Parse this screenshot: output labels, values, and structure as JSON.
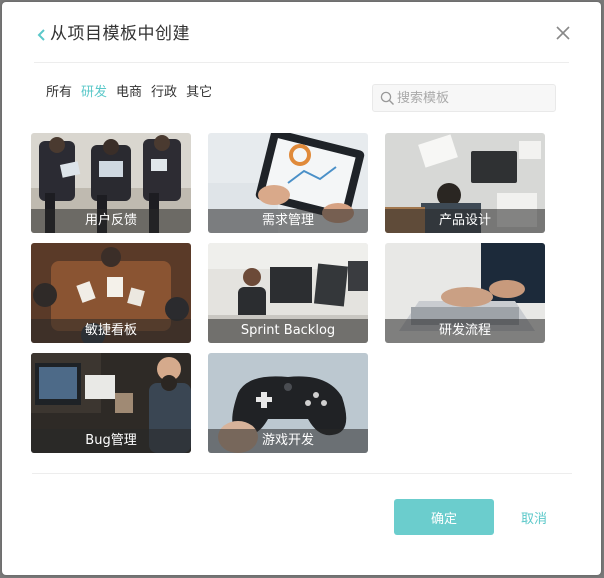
{
  "dialog": {
    "title": "从项目模板中创建",
    "back_icon": "chevron-left-icon",
    "close_icon": "close-icon"
  },
  "tabs": [
    {
      "label": "所有",
      "active": false
    },
    {
      "label": "研发",
      "active": true
    },
    {
      "label": "电商",
      "active": false
    },
    {
      "label": "行政",
      "active": false
    },
    {
      "label": "其它",
      "active": false
    }
  ],
  "search": {
    "placeholder": "搜索模板",
    "value": "",
    "icon": "search-icon"
  },
  "templates": [
    {
      "label": "用户反馈"
    },
    {
      "label": "需求管理"
    },
    {
      "label": "产品设计"
    },
    {
      "label": "敏捷看板"
    },
    {
      "label": "Sprint Backlog"
    },
    {
      "label": "研发流程"
    },
    {
      "label": "Bug管理"
    },
    {
      "label": "游戏开发"
    }
  ],
  "footer": {
    "confirm_label": "确定",
    "cancel_label": "取消"
  },
  "colors": {
    "accent": "#5bc8c9",
    "confirm_bg": "#6bcdcd",
    "overlay": "#7a7a7a"
  }
}
